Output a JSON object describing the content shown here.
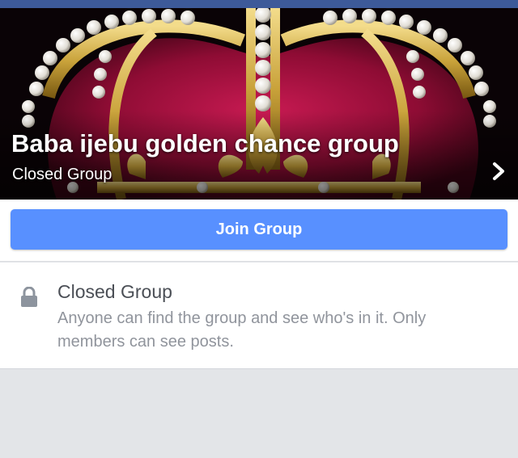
{
  "group": {
    "name": "Baba ijebu golden chance group",
    "privacy_label": "Closed Group"
  },
  "actions": {
    "join_label": "Join Group"
  },
  "privacy_info": {
    "title": "Closed Group",
    "description": "Anyone can find the group and see who's in it. Only members can see posts."
  },
  "icons": {
    "cover_chevron": "chevron-right-icon",
    "privacy": "lock-icon"
  },
  "colors": {
    "top_bar": "#3d5a99",
    "join_button": "#5890ff",
    "crown_velvet": "#a8103f",
    "crown_gold": "#c9a23a",
    "pearl": "#eae8e3"
  }
}
